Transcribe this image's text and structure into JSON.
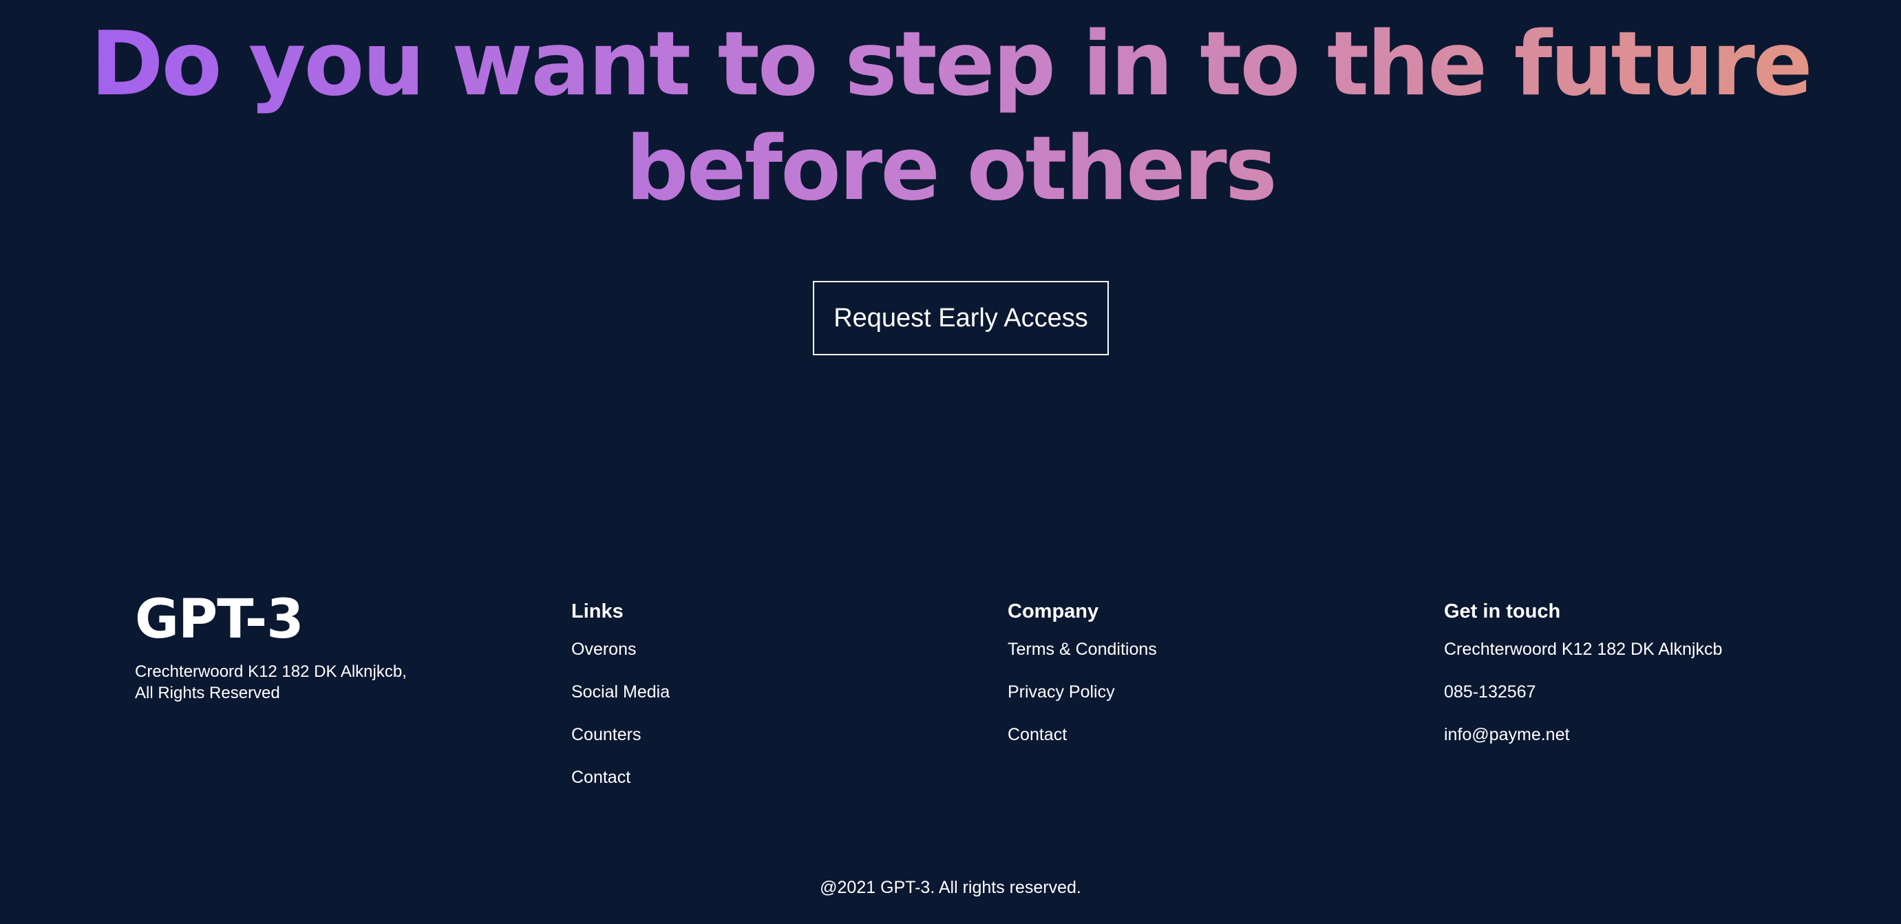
{
  "cta": {
    "headline_line1": "Do you want to step in to the future",
    "headline_line2": "before others",
    "button_label": "Request Early Access"
  },
  "footer": {
    "logo": "GPT-3",
    "address_line1": "Crechterwoord K12 182 DK Alknjkcb,",
    "address_line2": "All Rights Reserved",
    "links": {
      "heading": "Links",
      "items": [
        "Overons",
        "Social Media",
        "Counters",
        "Contact"
      ]
    },
    "company": {
      "heading": "Company",
      "items": [
        "Terms & Conditions",
        "Privacy Policy",
        "Contact"
      ]
    },
    "contact": {
      "heading": "Get in touch",
      "items": [
        "Crechterwoord K12 182 DK Alknjkcb",
        "085-132567",
        "info@payme.net"
      ]
    },
    "copyright": "@2021 GPT-3. All rights reserved."
  },
  "colors": {
    "background": "#0b1831",
    "gradient_start": "#9f5ff0",
    "gradient_mid": "#c47fd0",
    "gradient_end": "#e5967f",
    "text": "#ffffff"
  }
}
